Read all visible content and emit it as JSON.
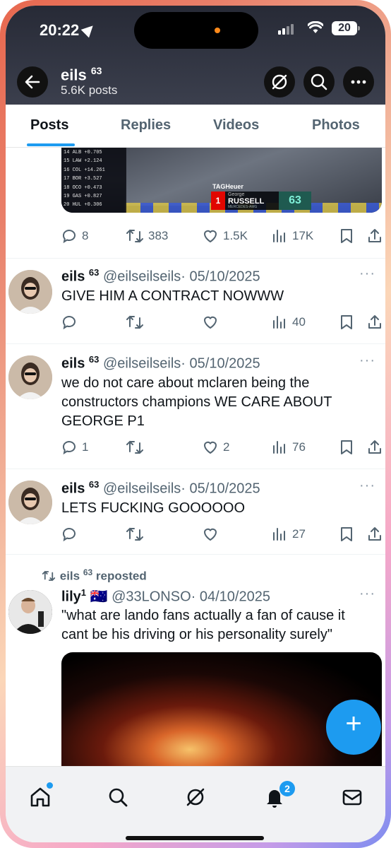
{
  "status": {
    "time": "20:22",
    "battery": "20"
  },
  "profile": {
    "name": "eils",
    "badge": "63",
    "posts": "5.6K posts"
  },
  "tabs": [
    "Posts",
    "Replies",
    "Videos",
    "Photos"
  ],
  "media_overlay": {
    "standings": [
      {
        "pos": "14",
        "team": "ALB",
        "gap": "+0.705"
      },
      {
        "pos": "15",
        "team": "LAW",
        "gap": "+2.124"
      },
      {
        "pos": "16",
        "team": "COL",
        "gap": "+14.261"
      },
      {
        "pos": "17",
        "team": "BOR",
        "gap": "+3.527"
      },
      {
        "pos": "18",
        "team": "OCO",
        "gap": "+0.473"
      },
      {
        "pos": "19",
        "team": "GAS",
        "gap": "+0.827"
      },
      {
        "pos": "20",
        "team": "HUL",
        "gap": "+0.306"
      }
    ],
    "sponsor": "TAGHeuer",
    "driver_first": "George",
    "driver_last": "RUSSELL",
    "team": "MERCEDES-AMG",
    "position": "1",
    "number": "63"
  },
  "top_post_actions": {
    "replies": "8",
    "reposts": "383",
    "likes": "1.5K",
    "views": "17K"
  },
  "posts": [
    {
      "name": "eils",
      "badge": "63",
      "handle": "@eilseilseils",
      "date": "· 05/10/2025",
      "text": "GIVE HIM A CONTRACT NOWWW",
      "replies": "",
      "reposts": "",
      "likes": "",
      "views": "40"
    },
    {
      "name": "eils",
      "badge": "63",
      "handle": "@eilseilseils",
      "date": "· 05/10/2025",
      "text": "we do not care about mclaren being the constructors champions WE CARE ABOUT GEORGE P1",
      "replies": "1",
      "reposts": "",
      "likes": "2",
      "views": "76"
    },
    {
      "name": "eils",
      "badge": "63",
      "handle": "@eilseilseils",
      "date": "· 05/10/2025",
      "text": "LETS FUCKING GOOOOOO",
      "replies": "",
      "reposts": "",
      "likes": "",
      "views": "27"
    }
  ],
  "repost": {
    "label": "eils",
    "label_badge": "63",
    "label_suffix": "reposted",
    "name": "lily",
    "name_sup": "1",
    "flag": "🇦🇺",
    "handle": "@33LONSO",
    "date": "· 04/10/2025",
    "text": "\"what are lando fans actually a fan of cause it cant be his driving or his personality surely\""
  },
  "fab_label": "+",
  "notifications_badge": "2",
  "colors": {
    "accent": "#1d9bf0",
    "header_bg": "#2a2d3a",
    "muted": "#536471"
  }
}
